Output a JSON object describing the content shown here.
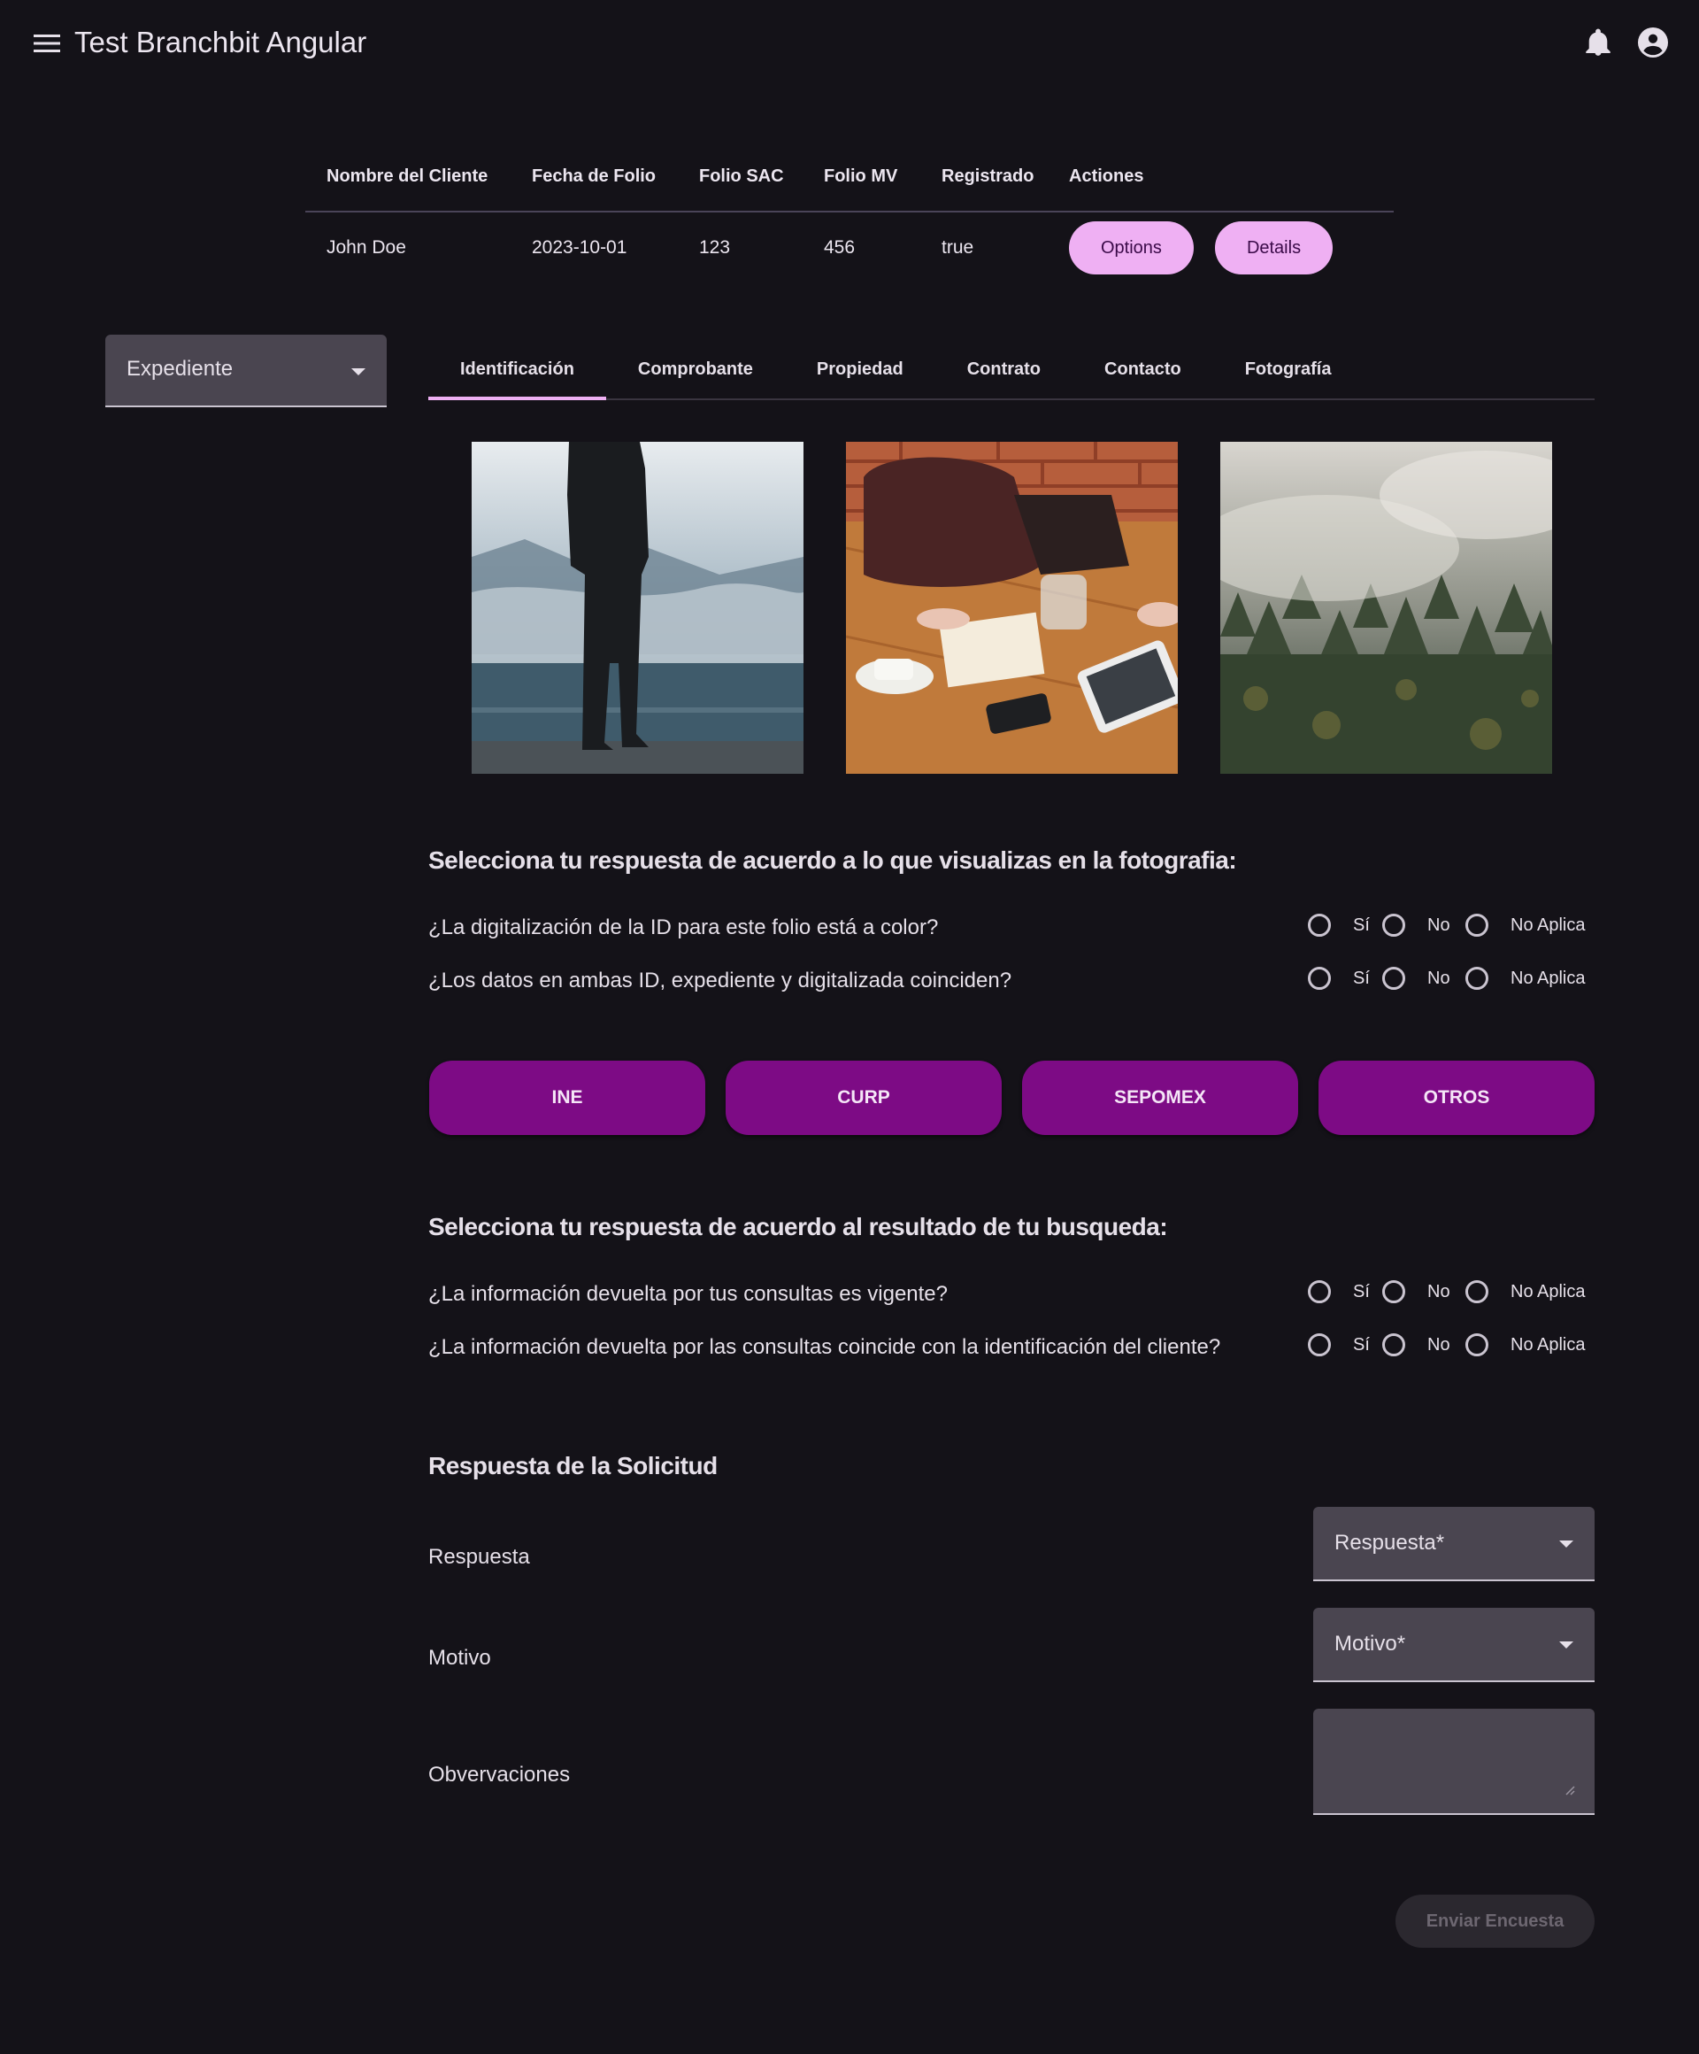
{
  "app": {
    "title": "Test Branchbit Angular"
  },
  "toolbar": {
    "menu_icon": "menu-icon",
    "notifications_icon": "bell-icon",
    "account_icon": "account-circle-icon"
  },
  "table": {
    "headers": [
      "Nombre del Cliente",
      "Fecha de Folio",
      "Folio SAC",
      "Folio MV",
      "Registrado",
      "Actiones"
    ],
    "rows": [
      {
        "nombre": "John Doe",
        "fecha": "2023-10-01",
        "folio_sac": "123",
        "folio_mv": "456",
        "registrado": "true",
        "options_label": "Options",
        "details_label": "Details"
      }
    ]
  },
  "expediente_select": {
    "value": "Expediente"
  },
  "tabs": [
    {
      "label": "Identificación",
      "active": true
    },
    {
      "label": "Comprobante",
      "active": false
    },
    {
      "label": "Propiedad",
      "active": false
    },
    {
      "label": "Contrato",
      "active": false
    },
    {
      "label": "Contacto",
      "active": false
    },
    {
      "label": "Fotografía",
      "active": false
    }
  ],
  "photos": [
    {
      "subject": "person-on-misty-lake-pier"
    },
    {
      "subject": "desk-with-bag-phone-tablet"
    },
    {
      "subject": "misty-forest"
    }
  ],
  "section1": {
    "title": "Selecciona tu respuesta de acuerdo a lo que visualizas en la fotografia:",
    "questions": [
      "¿La digitalización de la ID para este folio está a color?",
      "¿Los datos en ambas ID, expediente y digitalizada coinciden?"
    ]
  },
  "radio_options": [
    "Sí",
    "No",
    "No Aplica"
  ],
  "lookup_buttons": [
    "INE",
    "CURP",
    "SEPOMEX",
    "OTROS"
  ],
  "section2": {
    "title": "Selecciona tu respuesta de acuerdo al resultado de tu busqueda:",
    "questions": [
      "¿La información devuelta por tus consultas es vigente?",
      "¿La información devuelta por las consultas coincide con la identificación del cliente?"
    ]
  },
  "section3": {
    "title": "Respuesta de la Solicitud",
    "respuesta_label": "Respuesta",
    "respuesta_placeholder": "Respuesta*",
    "motivo_label": "Motivo",
    "motivo_placeholder": "Motivo*",
    "observaciones_label": "Obvervaciones",
    "observaciones_value": ""
  },
  "submit_label": "Enviar Encuesta",
  "colors": {
    "background": "#141218",
    "pill_button": "#efb0f3",
    "lookup_button": "#7d0b85",
    "field_fill": "#4a4550",
    "active_tab_indicator": "#efb0f3"
  }
}
